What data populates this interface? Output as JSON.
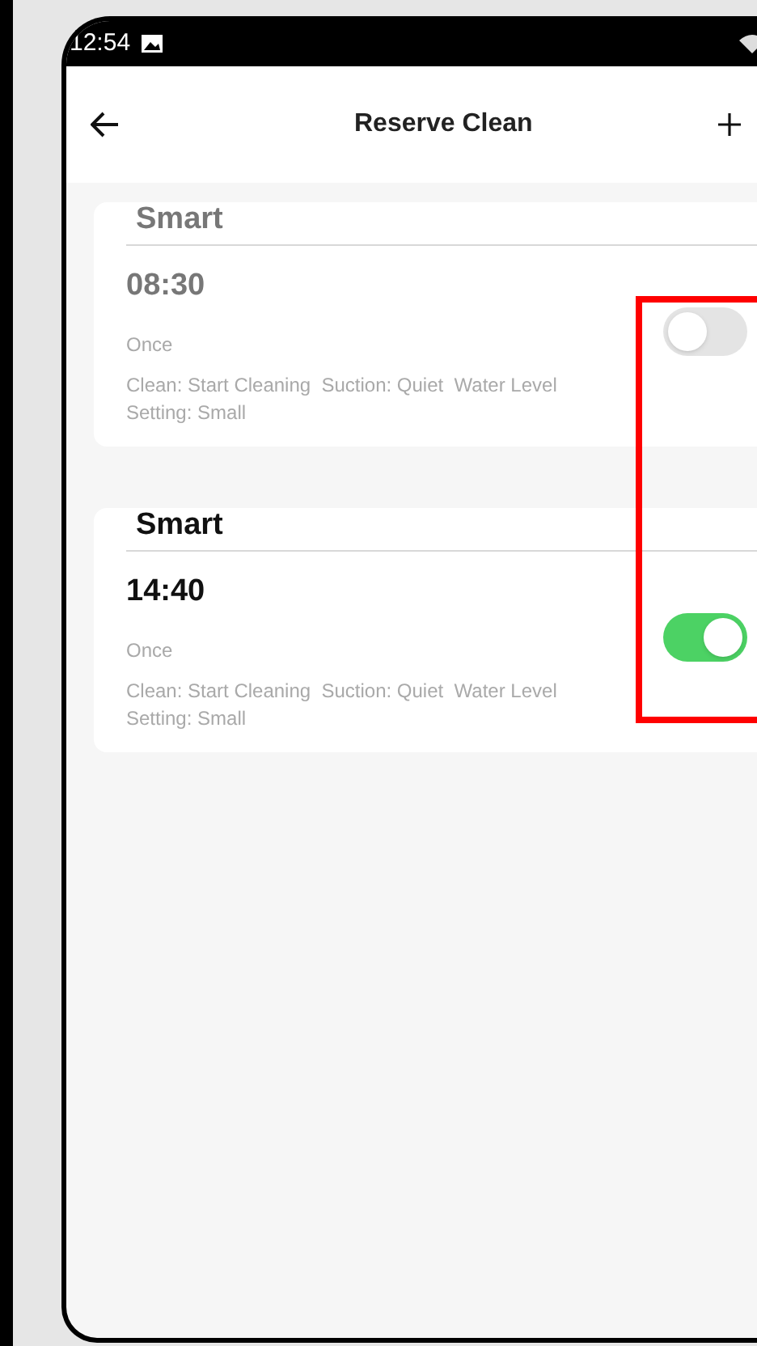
{
  "status_bar": {
    "time": "12:54"
  },
  "header": {
    "title": "Reserve Clean"
  },
  "schedules": [
    {
      "mode": "Smart",
      "time": "08:30",
      "repeat": "Once",
      "details": "Clean: Start Cleaning  Suction: Quiet  Water Level Setting: Small",
      "on": false
    },
    {
      "mode": "Smart",
      "time": "14:40",
      "repeat": "Once",
      "details": "Clean: Start Cleaning  Suction: Quiet  Water Level Setting: Small",
      "on": true
    }
  ]
}
